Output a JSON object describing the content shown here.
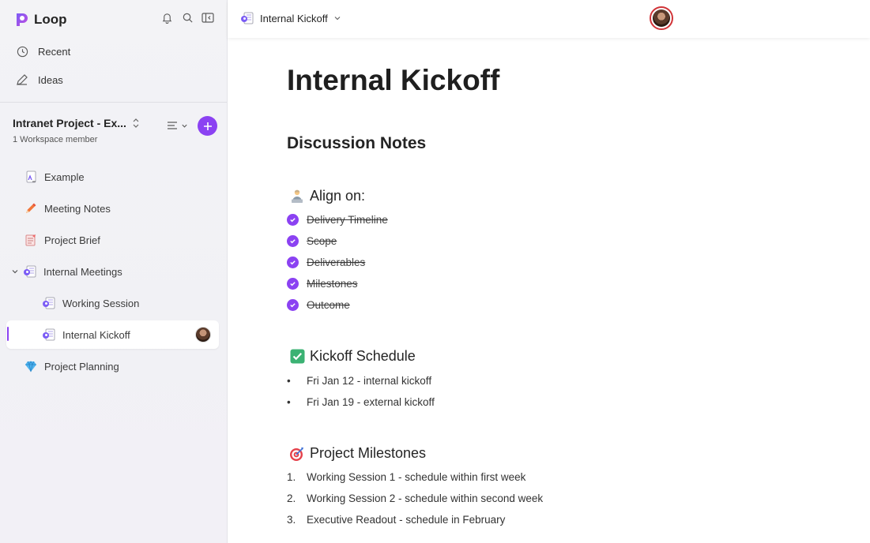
{
  "app": {
    "name": "Loop"
  },
  "sidebar": {
    "nav": [
      {
        "label": "Recent",
        "icon": "clock-icon"
      },
      {
        "label": "Ideas",
        "icon": "pencil-note-icon"
      }
    ],
    "workspace": {
      "title": "Intranet Project - Ex...",
      "members": "1 Workspace member"
    },
    "pages": [
      {
        "label": "Example",
        "icon": "loop-page-icon"
      },
      {
        "label": "Meeting Notes",
        "icon": "pencil-emoji-icon"
      },
      {
        "label": "Project Brief",
        "icon": "memo-emoji-icon"
      },
      {
        "label": "Internal Meetings",
        "icon": "loop-page-icon"
      },
      {
        "label": "Working Session",
        "icon": "loop-page-icon"
      },
      {
        "label": "Internal Kickoff",
        "icon": "loop-page-icon"
      },
      {
        "label": "Project Planning",
        "icon": "gem-emoji-icon"
      }
    ]
  },
  "header": {
    "breadcrumb": "Internal Kickoff"
  },
  "doc": {
    "title": "Internal Kickoff",
    "section_heading": "Discussion Notes",
    "align": {
      "heading": "Align on:",
      "items": [
        "Delivery Timeline",
        "Scope",
        "Deliverables",
        "Milestones",
        "Outcome"
      ]
    },
    "schedule": {
      "heading": "Kickoff Schedule",
      "items": [
        "Fri Jan 12 - internal kickoff",
        "Fri Jan 19 - external kickoff"
      ]
    },
    "milestones": {
      "heading": "Project Milestones",
      "items": [
        {
          "num": "1.",
          "text": "Working Session 1 - schedule within first week"
        },
        {
          "num": "2.",
          "text": "Working Session 2 - schedule within second week"
        },
        {
          "num": "3.",
          "text": "Executive Readout - schedule in February"
        }
      ]
    }
  },
  "colors": {
    "accent": "#8b42f2",
    "avatar_ring": "#d13438",
    "check_green": "#3bb273"
  }
}
